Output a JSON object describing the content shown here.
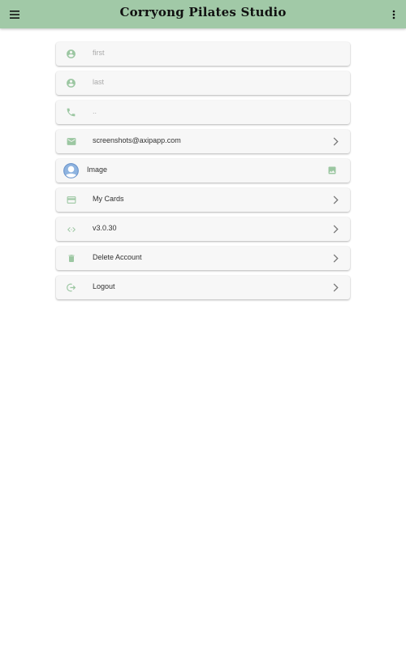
{
  "app": {
    "title": "Corryong Pilates Studio"
  },
  "colors": {
    "appbar": "#a1c9a7",
    "icon": "#9cc7a2"
  },
  "profile": {
    "first_placeholder": "first",
    "last_placeholder": "last",
    "phone_placeholder": "..",
    "email": "screenshots@axipapp.com",
    "image_label": "Image",
    "cards_label": "My Cards",
    "version": "v3.0.30",
    "delete_label": "Delete Account",
    "logout_label": "Logout"
  },
  "icons": {
    "menu": "menu-icon",
    "more": "more-vert-icon",
    "first": "account-circle-icon",
    "last": "account-circle-icon",
    "phone": "phone-icon",
    "email": "email-icon",
    "image_avatar": "avatar-icon",
    "image_action": "image-icon",
    "cards": "credit-card-icon",
    "version": "code-icon",
    "delete": "trash-icon",
    "logout": "logout-icon",
    "chevron": "chevron-right-icon"
  }
}
